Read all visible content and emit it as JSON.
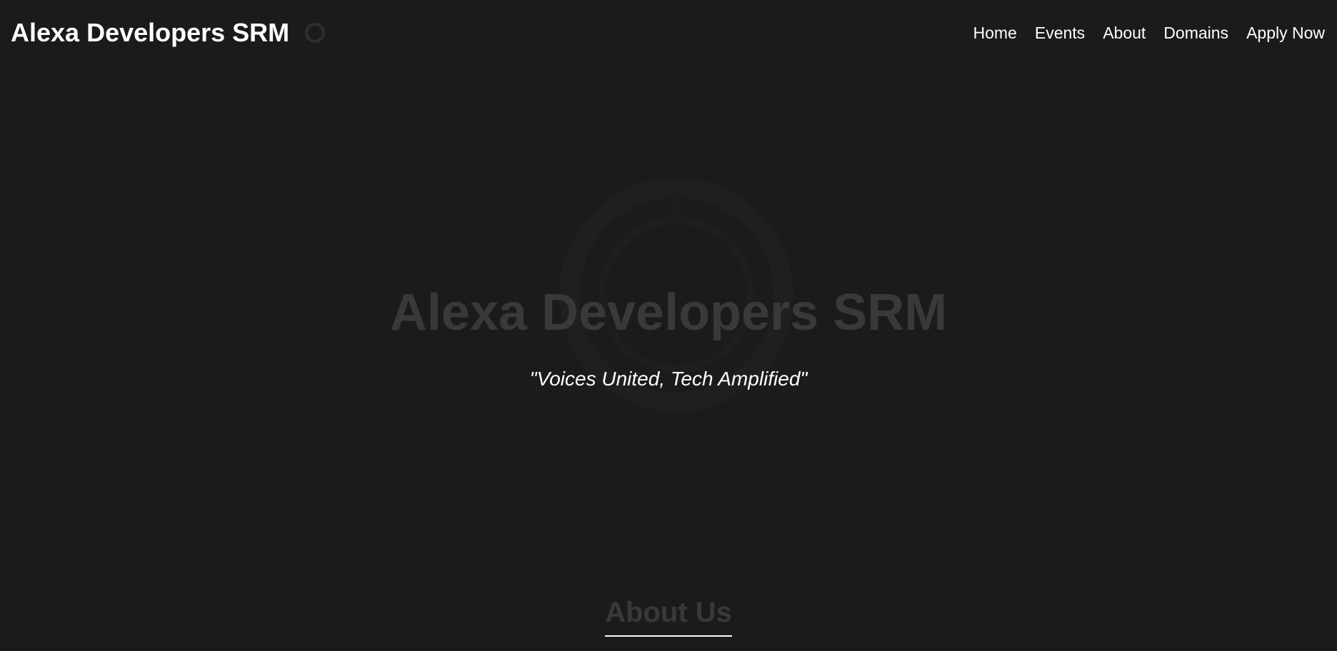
{
  "header": {
    "brand": "Alexa Developers SRM",
    "logo_icon": "alexa-ring-icon",
    "nav": [
      {
        "label": "Home"
      },
      {
        "label": "Events"
      },
      {
        "label": "About"
      },
      {
        "label": "Domains"
      },
      {
        "label": "Apply Now"
      }
    ]
  },
  "hero": {
    "title": "Alexa Developers SRM",
    "tagline": "\"Voices United, Tech Amplified\"",
    "background_icon": "alexa-ring-icon"
  },
  "about": {
    "title": "About Us"
  },
  "colors": {
    "background": "#1b1b1b",
    "text": "#ffffff",
    "muted_heading": "#3a3838"
  }
}
